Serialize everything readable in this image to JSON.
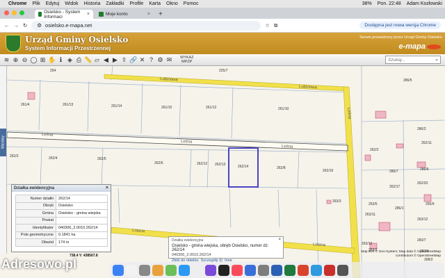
{
  "menubar": {
    "apple": "",
    "app": "Chrome",
    "items": [
      "Plik",
      "Edytuj",
      "Widok",
      "Historia",
      "Zakładki",
      "Profile",
      "Karta",
      "Okno",
      "Pomoc"
    ],
    "status": "38%",
    "datetime": "Pon. 22:48",
    "user": "Adam Kozłowski"
  },
  "tabs": [
    {
      "label": "Osielsko - System Informaci",
      "active": true
    },
    {
      "label": "Moje konto",
      "active": false
    }
  ],
  "address": {
    "url": "osielsko.e-mapa.net",
    "update": "Dostępna jest nowa wersja Chrome"
  },
  "banner": {
    "title": "Urząd Gminy Osielsko",
    "subtitle": "System Informacji Przestrzennej",
    "note": "Serwis prowadzony przez Urząd Gminy Osielsko",
    "brand": "e-mapa"
  },
  "toolbar": {
    "wykaz": "WYKAZ",
    "mpzp": "MPZP",
    "search_placeholder": "Szukaj..."
  },
  "side_tab": "Warstwy",
  "streets": {
    "lubinowa": "Lubinowa",
    "lesna": "Leśna",
    "lniana": "Lniana"
  },
  "parcels": [
    "254",
    "225/7",
    "286/5",
    "261/4",
    "261/13",
    "261/14",
    "261/15",
    "261/12",
    "261/10",
    "286/2",
    "262/3",
    "262/4",
    "262/5",
    "262/6",
    "262/12",
    "262/13",
    "262/14",
    "262/8",
    "262/16",
    "262/11",
    "286/6",
    "286/7",
    "262/20",
    "262/17",
    "263/3",
    "262/2",
    "263/5",
    "265/9",
    "286/1",
    "263/11",
    "263/12",
    "263/10",
    "283/2",
    "283/7",
    "283/6",
    "308/2"
  ],
  "panel": {
    "title": "Działka ewidencyjna",
    "rows": [
      [
        "Numer działki",
        "262/14"
      ],
      [
        "Obręb",
        "Osielsko"
      ],
      [
        "Gmina",
        "Osielsko - gmina wiejska"
      ],
      [
        "Powiat",
        ""
      ],
      [
        "Identyfikator",
        "040306_2.0010.262/14"
      ],
      [
        "Pole geometryczne",
        "0.1841 ha"
      ],
      [
        "Obwód",
        "174 m"
      ]
    ]
  },
  "coords": "738.4   Y: 438567.8",
  "infobox": {
    "head": "Działka ewidencyjna",
    "line1": "Osielsko - gmina wiejska, obręb Osielsko, numer dz: 262/14",
    "line2": "040306_2.0010.262/14",
    "links": [
      "Zbliż do obiektu",
      "Szczegóły (i)",
      "Inne"
    ]
  },
  "attribution": [
    "Map tiles © Geo-System; Map data © OpenStreetMap",
    "contributors © OpenStreetMap"
  ],
  "watermark": "Adresowo.pl",
  "colors": {
    "road": "#f1e04a",
    "parcel_selected": "#4a44c2",
    "panel_header": "#d6dfeb",
    "banner": "#c9952a"
  }
}
